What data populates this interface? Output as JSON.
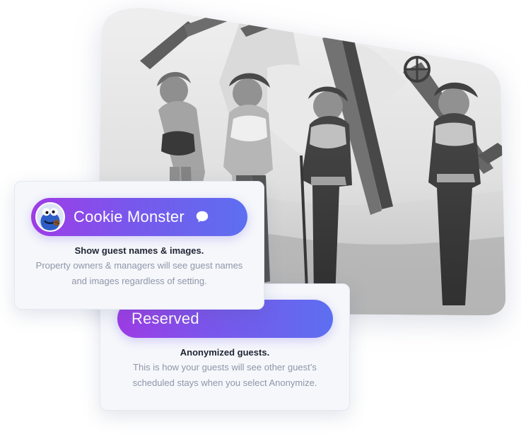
{
  "photo": {
    "alt": "Vintage photograph of four women carrying skis"
  },
  "card_names": {
    "pill_label": "Cookie Monster",
    "avatar_icon": "cookie-monster-avatar",
    "chat_icon": "chat-bubble-icon",
    "title": "Show guest names & images.",
    "description": "Property owners & managers will see guest names and images regardless of setting."
  },
  "card_anonymized": {
    "pill_label": "Reserved",
    "title": "Anonymized guests.",
    "description": "This is how your guests will see other guest’s scheduled stays when you select Anonymize."
  },
  "colors": {
    "pill_gradient_start": "#9e3ce6",
    "pill_gradient_end": "#5d6ff0",
    "card_background": "#f5f7fb",
    "title_text": "#1f2433",
    "body_text": "#8f96a8"
  }
}
